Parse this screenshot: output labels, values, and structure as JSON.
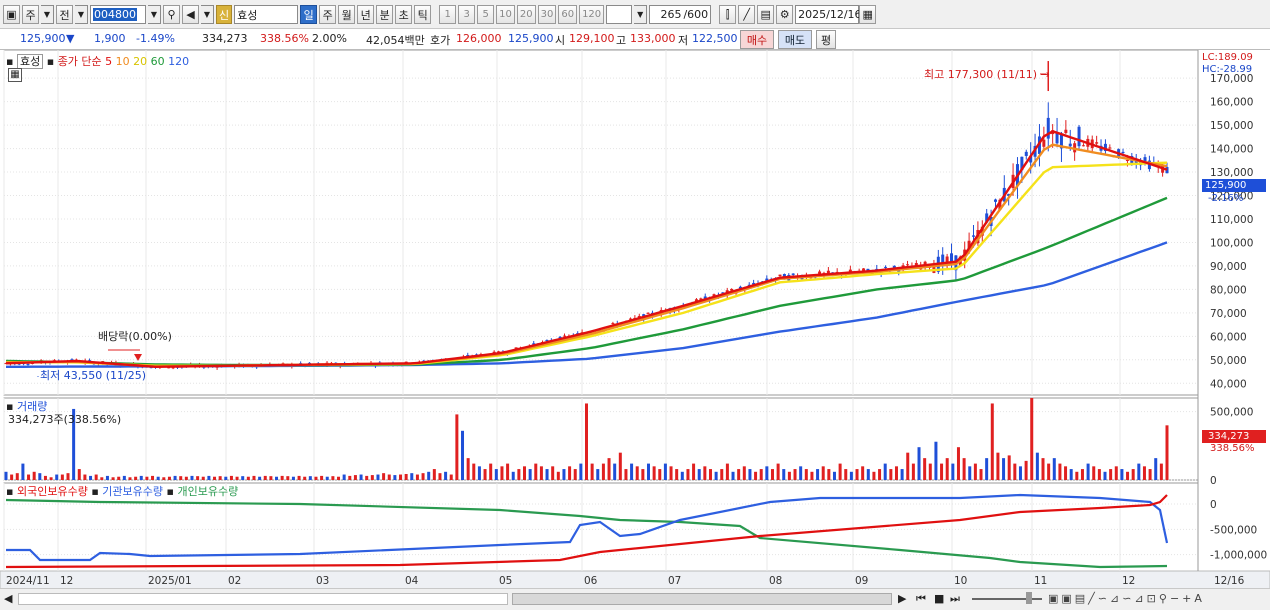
{
  "toolbar": {
    "market_btn": "주",
    "prev_btn": "전",
    "code": "004800",
    "credit_badge": "신",
    "stock_name": "효성",
    "periods": [
      "일",
      "주",
      "월",
      "년",
      "분",
      "초",
      "틱"
    ],
    "active_period": "일",
    "tick_options": [
      "1",
      "3",
      "5",
      "10",
      "20",
      "30",
      "60",
      "120"
    ],
    "count_value": "265",
    "count_total": "/600",
    "date": "2025/12/16"
  },
  "quote": {
    "price": "125,900",
    "change": "1,900",
    "change_pct": "-1.49%",
    "volume": "334,273",
    "volume_ratio": "338.56%",
    "turnover_rate": "2.00%",
    "amount": "42,054백만",
    "ask_label": "호가",
    "ask": "126,000",
    "bid": "125,900",
    "open_label": "시",
    "open": "129,100",
    "high_label": "고",
    "high": "133,000",
    "low_label": "저",
    "low": "122,500",
    "buy_label": "매수",
    "sell_label": "매도",
    "eval_label": "평"
  },
  "price_panel": {
    "legend_name": "효성",
    "legend_type": "종가 단순",
    "ma_periods": [
      "5",
      "10",
      "20",
      "60",
      "120"
    ],
    "lc_label": "LC:189.09",
    "hc_label": "HC:-28.99",
    "max_annotation": "최고 177,300 (11/11) →",
    "min_annotation": "최저 43,550 (11/25)",
    "dividend_annotation": "배당락(0.00%)",
    "current_tag": "125,900",
    "current_pct": "-2.16%",
    "y_ticks": [
      "170,000",
      "160,000",
      "150,000",
      "140,000",
      "130,000",
      "120,000",
      "110,000",
      "100,000",
      "90,000",
      "80,000",
      "70,000",
      "60,000",
      "50,000",
      "40,000"
    ]
  },
  "volume_panel": {
    "title": "거래량",
    "summary": "334,273주(338.56%)",
    "current_tag": "334,273",
    "current_pct": "338.56%",
    "y_ticks": [
      "500,000",
      "0"
    ]
  },
  "holdings_panel": {
    "series": [
      "외국인보유수량",
      "기관보유수량",
      "개인보유수량"
    ],
    "y_ticks": [
      "0",
      "-500,000",
      "-1,000,000"
    ]
  },
  "x_axis": {
    "labels": [
      "2024/11",
      "12",
      "2025/01",
      "02",
      "03",
      "04",
      "05",
      "06",
      "07",
      "08",
      "09",
      "10",
      "11",
      "12",
      "12/16"
    ]
  },
  "colors": {
    "up": "#e02020",
    "down": "#1e4fd8",
    "ma5": "#e01010",
    "ma10": "#f08c20",
    "ma20": "#f5e21a",
    "ma60": "#1f9a3a",
    "ma120": "#2e5fe0",
    "foreign": "#e01010",
    "institution": "#2e5fe0",
    "individual": "#2a9a50"
  },
  "chart_data": [
    {
      "type": "line",
      "name": "price",
      "x": [
        "2024-11",
        "2024-12",
        "2025-01",
        "2025-02",
        "2025-03",
        "2025-04",
        "2025-05",
        "2025-06",
        "2025-07",
        "2025-08",
        "2025-09",
        "2025-10",
        "2025-11-11",
        "2025-12-16"
      ],
      "series": [
        {
          "name": "5",
          "values": [
            48500,
            49500,
            47000,
            47500,
            48000,
            48500,
            53000,
            62000,
            73000,
            85000,
            88000,
            92000,
            148000,
            131000
          ]
        },
        {
          "name": "10",
          "values": [
            48800,
            49200,
            47200,
            47500,
            48000,
            48400,
            52500,
            61000,
            72000,
            84500,
            87500,
            91000,
            142000,
            132500
          ]
        },
        {
          "name": "20",
          "values": [
            49000,
            48900,
            47500,
            47500,
            47900,
            48200,
            52000,
            60000,
            70000,
            83000,
            86500,
            89000,
            132000,
            134000
          ]
        },
        {
          "name": "60",
          "values": [
            49500,
            49000,
            48000,
            47800,
            47700,
            48000,
            50000,
            55000,
            63000,
            73000,
            80000,
            84000,
            98000,
            119000
          ]
        },
        {
          "name": "120",
          "values": [
            47000,
            47100,
            47200,
            47300,
            47500,
            47800,
            48500,
            50500,
            55000,
            62000,
            68000,
            75000,
            82000,
            100000
          ]
        }
      ],
      "max": {
        "value": 177300,
        "date": "11/11"
      },
      "min": {
        "value": 43550,
        "date": "11/25"
      },
      "ylim": [
        35000,
        182000
      ]
    },
    {
      "type": "bar",
      "name": "volume",
      "values": [
        30,
        20,
        25,
        60,
        20,
        30,
        25,
        15,
        10,
        20,
        20,
        25,
        260,
        40,
        20,
        15,
        20,
        10,
        15,
        10,
        12,
        15,
        10,
        12,
        15,
        12,
        15,
        12,
        10,
        12,
        15,
        14,
        12,
        15,
        14,
        12,
        15,
        12,
        14,
        12,
        15,
        12,
        14,
        12,
        15,
        12,
        15,
        14,
        12,
        15,
        14,
        12,
        15,
        12,
        14,
        12,
        15,
        12,
        14,
        12,
        20,
        15,
        18,
        20,
        15,
        18,
        20,
        25,
        20,
        18,
        20,
        22,
        25,
        20,
        25,
        30,
        40,
        25,
        30,
        20,
        240,
        180,
        80,
        60,
        50,
        40,
        60,
        40,
        50,
        60,
        30,
        40,
        50,
        40,
        60,
        50,
        40,
        50,
        30,
        40,
        50,
        40,
        60,
        280,
        60,
        40,
        60,
        80,
        60,
        100,
        40,
        60,
        50,
        40,
        60,
        50,
        40,
        60,
        50,
        40,
        30,
        40,
        60,
        40,
        50,
        40,
        30,
        40,
        60,
        30,
        40,
        50,
        40,
        30,
        40,
        50,
        40,
        60,
        40,
        30,
        40,
        50,
        40,
        30,
        40,
        50,
        40,
        30,
        60,
        40,
        30,
        40,
        50,
        40,
        30,
        40,
        60,
        40,
        50,
        40,
        100,
        60,
        120,
        80,
        60,
        140,
        60,
        80,
        60,
        120,
        80,
        50,
        60,
        40,
        80,
        280,
        100,
        80,
        90,
        60,
        50,
        70,
        300,
        100,
        80,
        60,
        80,
        60,
        50,
        40,
        30,
        40,
        60,
        50,
        40,
        30,
        40,
        50,
        40,
        30,
        40,
        60,
        50,
        40,
        80,
        60,
        200
      ],
      "ylim": [
        0,
        600000
      ]
    }
  ]
}
